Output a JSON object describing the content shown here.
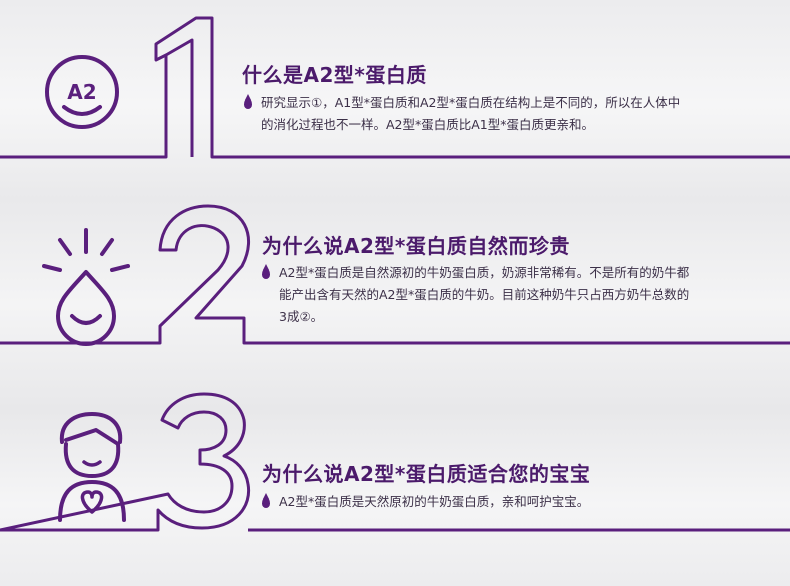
{
  "colors": {
    "accent": "#5a1f7d",
    "title": "#4b1a6b",
    "text": "#3c3048"
  },
  "sections": [
    {
      "number": "1",
      "icon": "a2-smile-icon",
      "icon_text": "A2",
      "title": "什么是A2型*蛋白质",
      "lines": [
        "研究显示①，A1型*蛋白质和A2型*蛋白质在结构上是不同的，所以在人体中",
        "的消化过程也不一样。A2型*蛋白质比A1型*蛋白质更亲和。"
      ]
    },
    {
      "number": "2",
      "icon": "shining-drop-icon",
      "title": "为什么说A2型*蛋白质自然而珍贵",
      "lines": [
        "A2型*蛋白质是自然源初的牛奶蛋白质，奶源非常稀有。不是所有的奶牛都",
        "能产出含有天然的A2型*蛋白质的牛奶。目前这种奶牛只占西方奶牛总数的",
        "3成②。"
      ]
    },
    {
      "number": "3",
      "icon": "baby-heart-icon",
      "title": "为什么说A2型*蛋白质适合您的宝宝",
      "lines": [
        "A2型*蛋白质是天然原初的牛奶蛋白质，亲和呵护宝宝。"
      ]
    }
  ]
}
